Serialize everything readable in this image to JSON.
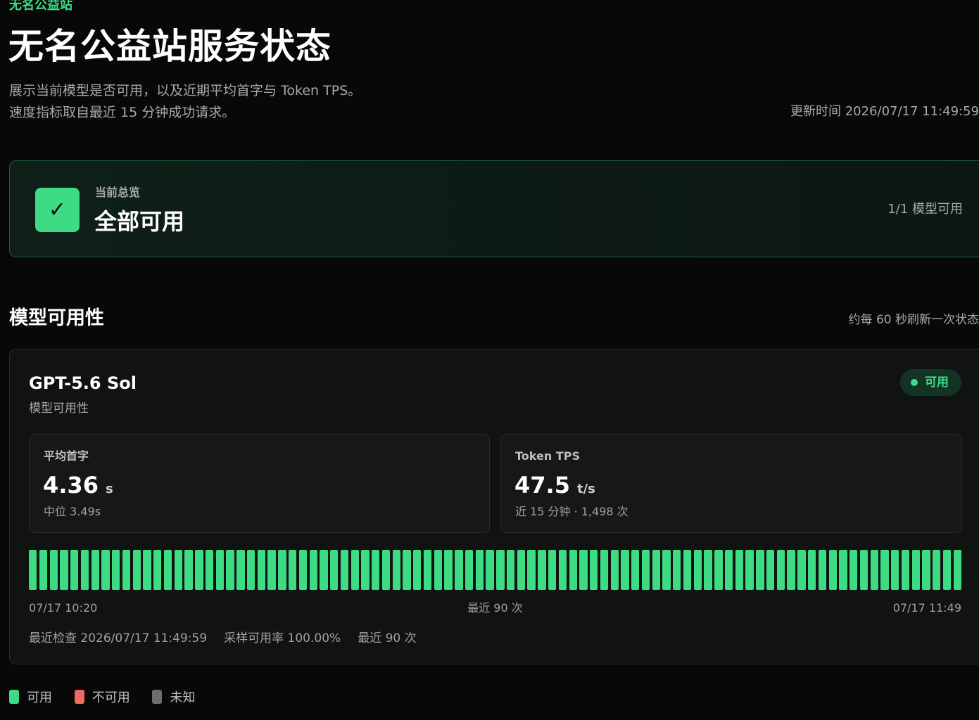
{
  "header": {
    "eyebrow": "无名公益站",
    "title": "无名公益站服务状态",
    "subtitle_line1": "展示当前模型是否可用，以及近期平均首字与 Token TPS。",
    "subtitle_line2": "速度指标取自最近 15 分钟成功请求。",
    "updated": "更新时间 2026/07/17 11:49:59"
  },
  "overview": {
    "icon": "check-icon",
    "check_glyph": "✓",
    "label": "当前总览",
    "status": "全部可用",
    "count": "1/1 模型可用"
  },
  "section": {
    "title": "模型可用性",
    "note": "约每 60 秒刷新一次状态"
  },
  "model": {
    "name": "GPT-5.6 Sol",
    "subtitle": "模型可用性",
    "badge": "可用",
    "metrics": {
      "first_token": {
        "label": "平均首字",
        "value": "4.36",
        "unit": "s",
        "sub": "中位 3.49s"
      },
      "tps": {
        "label": "Token TPS",
        "value": "47.5",
        "unit": "t/s",
        "sub": "近 15 分钟 · 1,498 次"
      }
    },
    "history": {
      "count": 90,
      "statuses_all": "available",
      "start_label": "07/17 10:20",
      "center_label": "最近 90 次",
      "end_label": "07/17 11:49"
    },
    "footer": {
      "last_check": "最近检查 2026/07/17 11:49:59",
      "sample_rate": "采样可用率 100.00%",
      "recent": "最近 90 次"
    }
  },
  "legend": {
    "available": "可用",
    "unavailable": "不可用",
    "unknown": "未知"
  },
  "colors": {
    "accent": "#3ddc84",
    "unavailable": "#ef6b5f",
    "unknown": "#6b6f6d"
  }
}
